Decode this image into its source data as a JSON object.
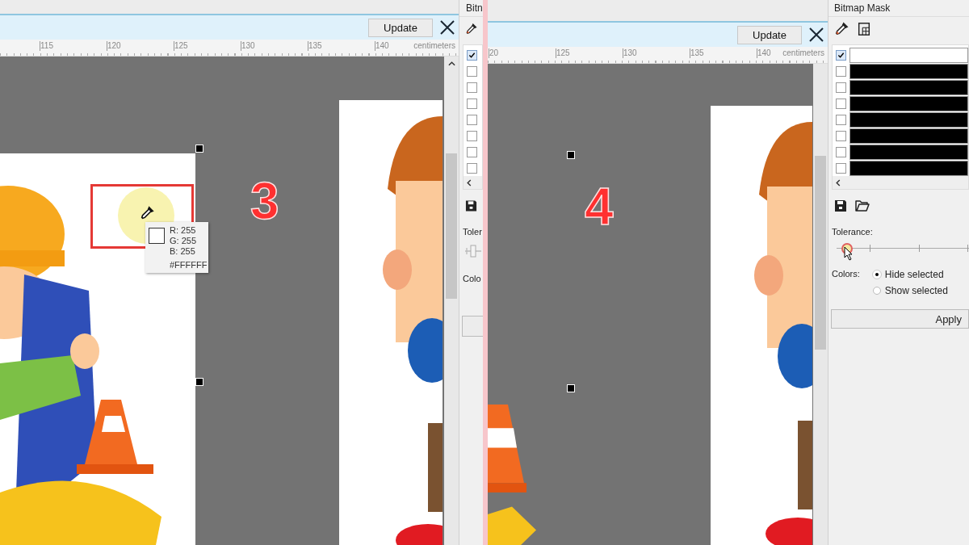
{
  "panels": [
    {
      "step_label": "3",
      "update_button": "Update",
      "ruler": {
        "ticks": [
          "115",
          "120",
          "125",
          "130",
          "135",
          "140"
        ],
        "unit": "centimeters"
      },
      "tooltip": {
        "lines": [
          "R: 255",
          "G: 255",
          "B: 255"
        ],
        "hex": "#FFFFFF"
      },
      "docker": {
        "title": "Bitn",
        "rows": [
          {
            "checked": true
          },
          {
            "checked": false
          },
          {
            "checked": false
          },
          {
            "checked": false
          },
          {
            "checked": false
          },
          {
            "checked": false
          },
          {
            "checked": false
          },
          {
            "checked": false
          }
        ],
        "tolerance_label": "Toler",
        "colors_label": "Colo"
      }
    },
    {
      "step_label": "4",
      "update_button": "Update",
      "ruler": {
        "ticks": [
          "20",
          "125",
          "130",
          "135",
          "140"
        ],
        "unit": "centimeters"
      },
      "docker": {
        "title": "Bitmap Mask",
        "rows": [
          {
            "checked": true,
            "color": "#ffffff"
          },
          {
            "checked": false,
            "color": "#000000"
          },
          {
            "checked": false,
            "color": "#000000"
          },
          {
            "checked": false,
            "color": "#000000"
          },
          {
            "checked": false,
            "color": "#000000"
          },
          {
            "checked": false,
            "color": "#000000"
          },
          {
            "checked": false,
            "color": "#000000"
          },
          {
            "checked": false,
            "color": "#000000"
          }
        ],
        "tolerance_label": "Tolerance:",
        "tolerance": {
          "level": 0.07
        },
        "colors_label": "Colors:",
        "options": [
          {
            "label": "Hide selected",
            "selected": true
          },
          {
            "label": "Show selected",
            "selected": false
          }
        ],
        "apply_button": "Apply"
      }
    }
  ]
}
